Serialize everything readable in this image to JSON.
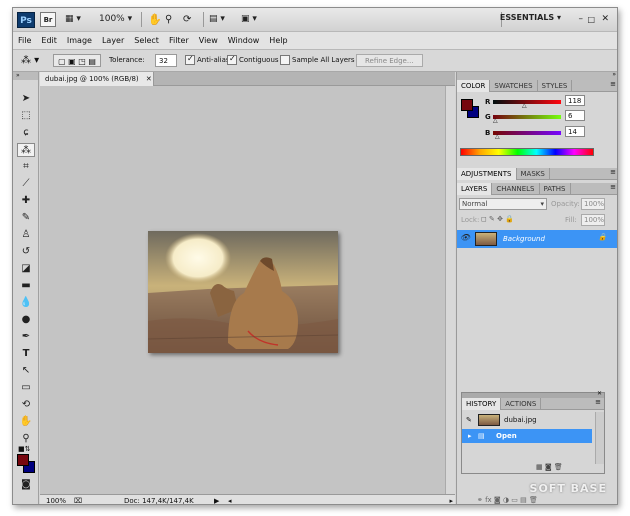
{
  "titlebar": {
    "logo": "Ps",
    "bridge": "Br",
    "zoom_value": "100%",
    "workspace": "ESSENTIALS"
  },
  "menu": [
    "File",
    "Edit",
    "Image",
    "Layer",
    "Select",
    "Filter",
    "View",
    "Window",
    "Help"
  ],
  "options": {
    "tolerance_label": "Tolerance:",
    "tolerance_value": "32",
    "antialias_label": "Anti-alias",
    "contiguous_label": "Contiguous",
    "sample_all_label": "Sample All Layers",
    "refine_edge_label": "Refine Edge..."
  },
  "document": {
    "tab_title": "dubai.jpg @ 100% (RGB/8)",
    "status_zoom": "100%",
    "status_doc": "Doc: 147,4K/147,4K"
  },
  "color_panel": {
    "tabs": [
      "COLOR",
      "SWATCHES",
      "STYLES"
    ],
    "r_label": "R",
    "r_value": "118",
    "g_label": "G",
    "g_value": "6",
    "b_label": "B",
    "b_value": "14",
    "fg_color": "#76060e",
    "bg_color": "#000080"
  },
  "adjustments_panel": {
    "tabs": [
      "ADJUSTMENTS",
      "MASKS"
    ]
  },
  "layers_panel": {
    "tabs": [
      "LAYERS",
      "CHANNELS",
      "PATHS"
    ],
    "blend_mode": "Normal",
    "opacity_label": "Opacity:",
    "opacity_value": "100%",
    "lock_label": "Lock:",
    "fill_label": "Fill:",
    "fill_value": "100%",
    "layer_name": "Background"
  },
  "history_panel": {
    "tabs": [
      "HISTORY",
      "ACTIONS"
    ],
    "snapshot_name": "dubai.jpg",
    "step": "Open"
  },
  "watermark": "SOFT BASE"
}
